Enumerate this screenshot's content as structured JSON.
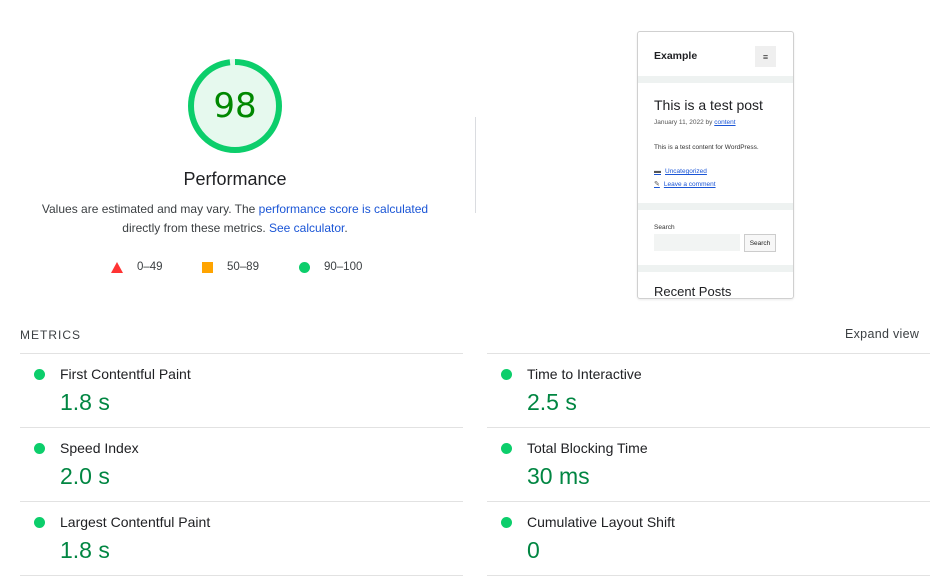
{
  "score": {
    "value": "98",
    "fraction": 0.98,
    "ring_color": "#0cce6b",
    "fill_color": "#e6f9ee",
    "text_color": "#008800"
  },
  "category_title": "Performance",
  "description": {
    "part1": "Values are estimated and may vary. The ",
    "link1": "performance score is calculated",
    "part2": "directly from these metrics. ",
    "link2": "See calculator",
    "part3": "."
  },
  "legend": [
    {
      "icon": "triangle-icon",
      "label": "0–49",
      "color": "#ff3333"
    },
    {
      "icon": "square-icon",
      "label": "50–89",
      "color": "#ffa400"
    },
    {
      "icon": "circle-icon",
      "label": "90–100",
      "color": "#0cce6b"
    }
  ],
  "screenshot": {
    "site_title": "Example",
    "menu_icon": "≡",
    "post_title": "This is a test post",
    "post_date": "January 11, 2022 by ",
    "post_author": "content",
    "post_body": "This is a test content for WordPress.",
    "category": "Uncategorized",
    "comment_link": "Leave a comment",
    "search_label": "Search",
    "search_button": "Search",
    "recent_posts": "Recent Posts"
  },
  "metrics_header": "METRICS",
  "expand_view": "Expand view",
  "metrics": [
    {
      "name": "First Contentful Paint",
      "value": "1.8 s"
    },
    {
      "name": "Time to Interactive",
      "value": "2.5 s"
    },
    {
      "name": "Speed Index",
      "value": "2.0 s"
    },
    {
      "name": "Total Blocking Time",
      "value": "30 ms"
    },
    {
      "name": "Largest Contentful Paint",
      "value": "1.8 s"
    },
    {
      "name": "Cumulative Layout Shift",
      "value": "0"
    }
  ],
  "pass_color": "#0cce6b",
  "value_color": "#018642"
}
